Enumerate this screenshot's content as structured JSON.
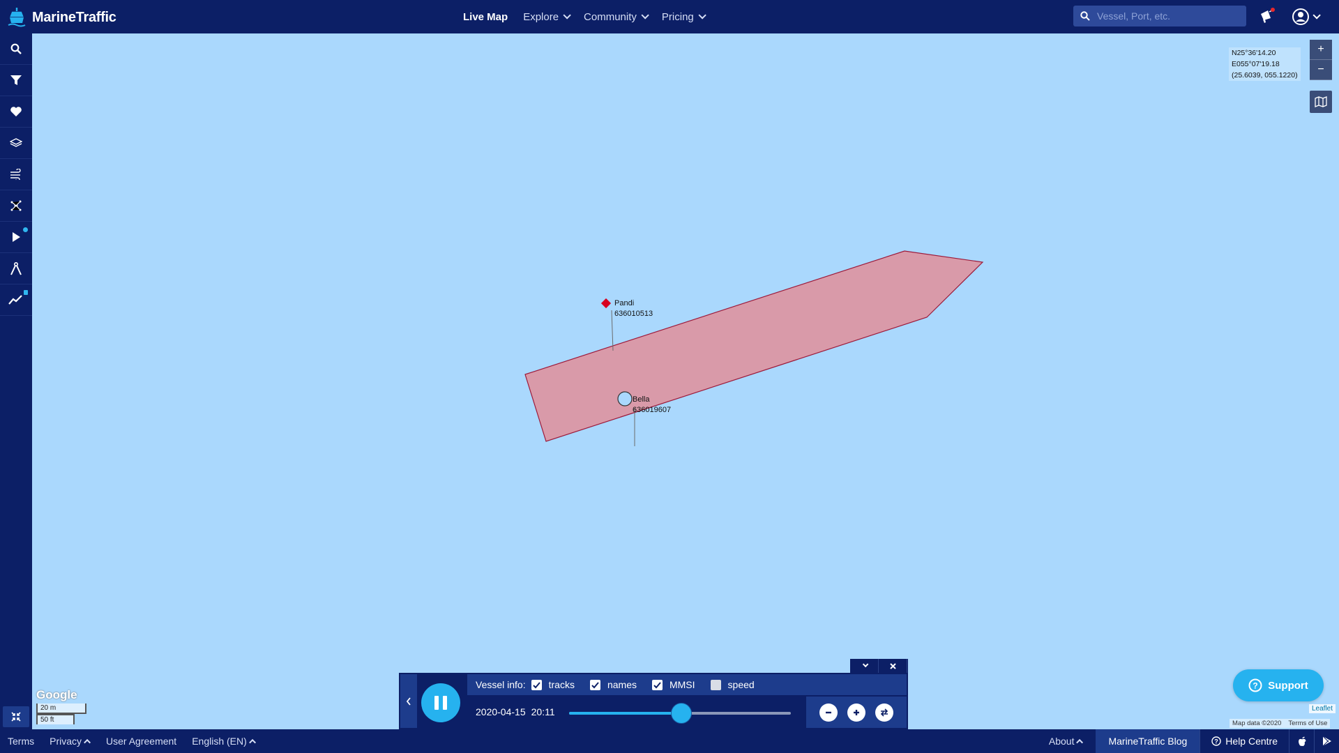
{
  "header": {
    "brand": "MarineTraffic",
    "nav": [
      {
        "label": "Live Map",
        "active": true
      },
      {
        "label": "Explore"
      },
      {
        "label": "Community"
      },
      {
        "label": "Pricing"
      }
    ],
    "search_placeholder": "Vessel, Port, etc."
  },
  "sidebar": {
    "items": [
      {
        "icon": "search-icon"
      },
      {
        "icon": "filter-icon"
      },
      {
        "icon": "heart-icon"
      },
      {
        "icon": "layers-icon"
      },
      {
        "icon": "wind-icon"
      },
      {
        "icon": "density-icon"
      },
      {
        "icon": "play-icon",
        "badge": true
      },
      {
        "icon": "measure-icon"
      },
      {
        "icon": "chart-icon",
        "locked": true
      }
    ]
  },
  "map": {
    "coordinates": {
      "lat": "N25°36'14.20",
      "lon": "E055°07'19.18",
      "decimal": "(25.6039, 055.1220)"
    },
    "zoom_in": "+",
    "zoom_out": "−",
    "vessels": [
      {
        "name": "Pandi",
        "mmsi": "636010513",
        "marker": "diamond",
        "color": "#d7001f"
      },
      {
        "name": "Bella",
        "mmsi": "636019607",
        "marker": "circle",
        "color": "#aad8fd"
      }
    ],
    "google_logo": "Google",
    "scale": {
      "metric": "20 m",
      "imperial": "50 ft"
    },
    "leaflet": "Leaflet",
    "map_data": "Map data ©2020",
    "terms_of_use": "Terms of Use"
  },
  "support": {
    "label": "Support"
  },
  "playback": {
    "vessel_info_label": "Vessel info:",
    "options": [
      {
        "label": "tracks",
        "checked": true
      },
      {
        "label": "names",
        "checked": true
      },
      {
        "label": "MMSI",
        "checked": true
      },
      {
        "label": "speed",
        "checked": false
      }
    ],
    "date": "2020-04-15",
    "time": "20:11",
    "progress": 0.5,
    "collapse_icon": "chevron-left-icon",
    "state": "playing"
  },
  "footer": {
    "left": [
      {
        "label": "Terms"
      },
      {
        "label": "Privacy",
        "chevron": true
      },
      {
        "label": "User Agreement"
      },
      {
        "label": "English (EN)",
        "chevron": true
      }
    ],
    "about": "About",
    "blog": "MarineTraffic Blog",
    "help": "Help Centre"
  },
  "colors": {
    "navy": "#0c1f66",
    "accent": "#26b2ef",
    "sea": "#aad8fd",
    "area_fill": "#d99aa9",
    "area_stroke": "#9c1a3a"
  }
}
